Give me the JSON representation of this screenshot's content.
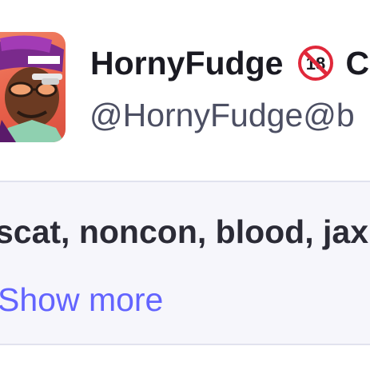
{
  "account": {
    "display_name": "HornyFudge",
    "badge_icon": "no-under-18-icon",
    "badge_text": "18",
    "after_badge_text": "C",
    "handle": "@HornyFudge@b"
  },
  "bio": {
    "text": "scat, noncon, blood, jax",
    "show_more_label": "Show more"
  },
  "colors": {
    "name": "#1a1a22",
    "handle": "#4c4f63",
    "link": "#6364ff",
    "bio_bg": "#f6f6fb",
    "avatar_bg": "#e8604a"
  }
}
